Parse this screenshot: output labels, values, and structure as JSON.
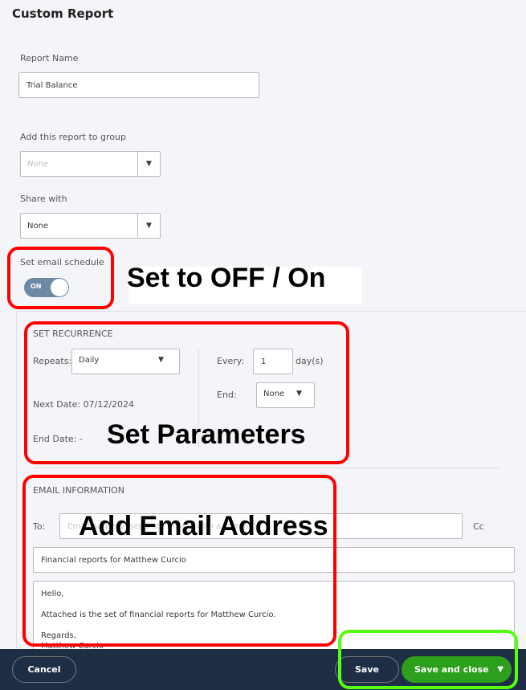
{
  "page_title": "Custom Report",
  "report_name": {
    "label": "Report Name",
    "value": "Trial Balance"
  },
  "group": {
    "label": "Add this report to group",
    "placeholder": "None"
  },
  "share": {
    "label": "Share with",
    "value": "None"
  },
  "schedule": {
    "label": "Set email schedule",
    "toggle": "ON",
    "enabled": true
  },
  "recurrence": {
    "heading": "SET RECURRENCE",
    "repeats_label": "Repeats:",
    "repeats_value": "Daily",
    "every_label": "Every:",
    "every_value": "1",
    "every_unit": "day(s)",
    "end_label": "End:",
    "end_value": "None",
    "next_date": "Next Date: 07/12/2024",
    "end_date": "End Date: -"
  },
  "email": {
    "heading": "EMAIL INFORMATION",
    "to_label": "To:",
    "to_placeholder": "Email address (separate emails with a comma)",
    "cc_label": "Cc",
    "subject": "Financial reports for Matthew Curcio",
    "body": [
      "Hello,",
      "Attached is the set of financial reports for Matthew Curcio.",
      "Regards,",
      "Matthew Curcio"
    ]
  },
  "footer": {
    "cancel": "Cancel",
    "save": "Save",
    "save_close": "Save and close"
  },
  "annotations": {
    "toggle": "Set to OFF / On",
    "params": "Set Parameters",
    "email": "Add Email Address"
  },
  "colors": {
    "toggle": "#6c89a6",
    "footer": "#1e2f45",
    "save_close": "#2ca01c",
    "highlight_red": "#ff0000",
    "highlight_green": "#55ff11"
  }
}
